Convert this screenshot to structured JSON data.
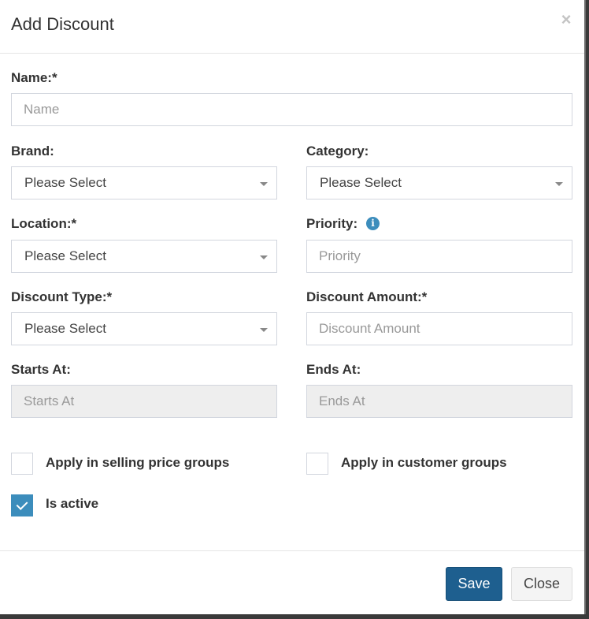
{
  "modal": {
    "title": "Add Discount",
    "close_symbol": "×"
  },
  "fields": {
    "name": {
      "label": "Name:*",
      "placeholder": "Name",
      "value": ""
    },
    "brand": {
      "label": "Brand:",
      "selected": "Please Select"
    },
    "category": {
      "label": "Category:",
      "selected": "Please Select"
    },
    "location": {
      "label": "Location:*",
      "selected": "Please Select"
    },
    "priority": {
      "label": "Priority:",
      "placeholder": "Priority",
      "value": "",
      "info_icon": "info-circle"
    },
    "discount_type": {
      "label": "Discount Type:*",
      "selected": "Please Select"
    },
    "discount_amount": {
      "label": "Discount Amount:*",
      "placeholder": "Discount Amount",
      "value": ""
    },
    "starts_at": {
      "label": "Starts At:",
      "placeholder": "Starts At",
      "value": ""
    },
    "ends_at": {
      "label": "Ends At:",
      "placeholder": "Ends At",
      "value": ""
    }
  },
  "checkboxes": {
    "selling_price_groups": {
      "label": "Apply in selling price groups",
      "checked": false
    },
    "customer_groups": {
      "label": "Apply in customer groups",
      "checked": false
    },
    "is_active": {
      "label": "Is active",
      "checked": true
    }
  },
  "footer": {
    "save_label": "Save",
    "close_label": "Close"
  },
  "colors": {
    "primary": "#1e5f8f",
    "checkbox_accent": "#3c8dbc",
    "disabled_bg": "#eeeeee",
    "border": "#d2d6de"
  }
}
